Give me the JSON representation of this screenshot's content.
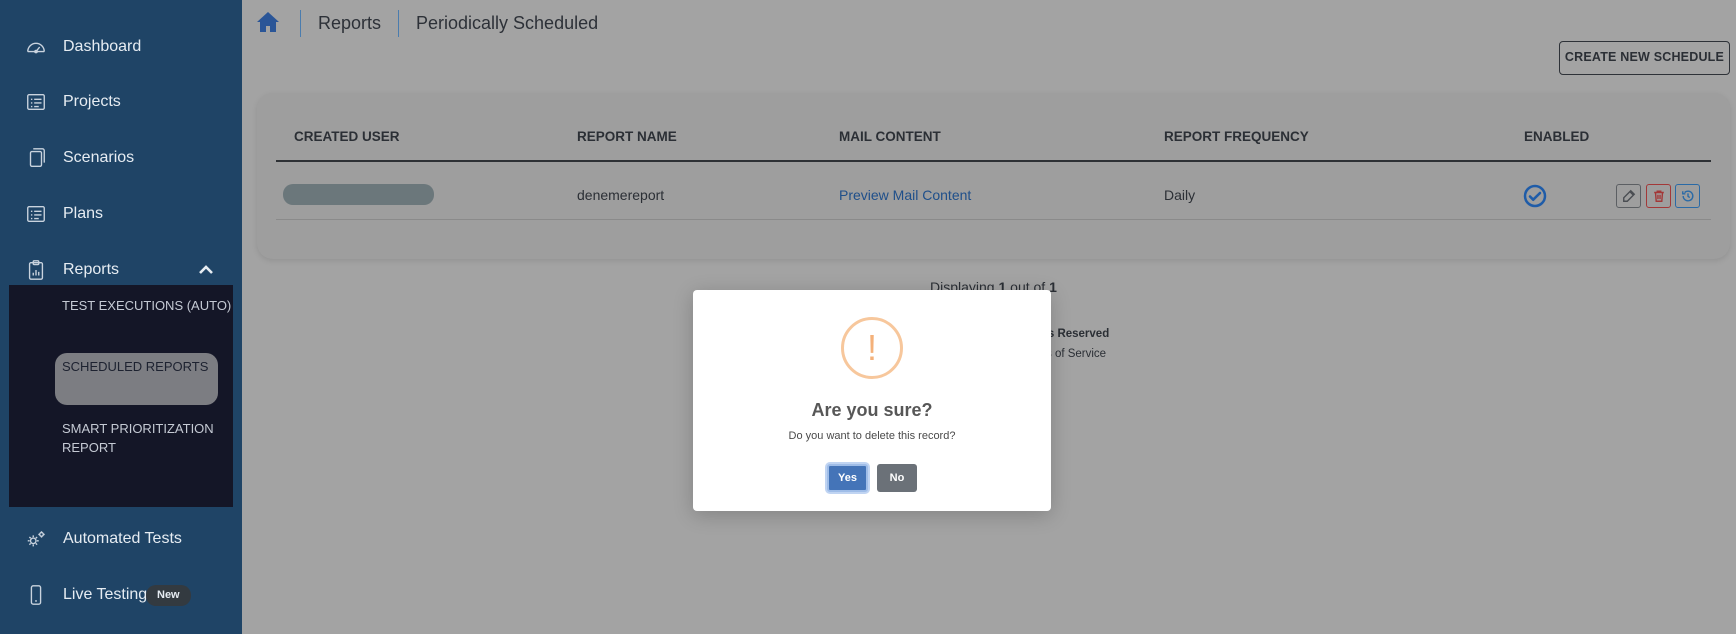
{
  "sidebar": {
    "items": [
      {
        "label": "Dashboard",
        "icon": "dashboard-icon"
      },
      {
        "label": "Projects",
        "icon": "list-icon"
      },
      {
        "label": "Scenarios",
        "icon": "copy-icon"
      },
      {
        "label": "Plans",
        "icon": "list-icon"
      },
      {
        "label": "Reports",
        "icon": "clipboard-chart-icon",
        "expanded": true
      },
      {
        "label": "Automated Tests",
        "icon": "gears-icon"
      },
      {
        "label": "Live Testing",
        "icon": "mobile-icon",
        "badge": "New"
      }
    ],
    "reports_submenu": [
      {
        "label": "TEST EXECUTIONS (AUTO)"
      },
      {
        "label": "SCHEDULED REPORTS",
        "active": true
      },
      {
        "label": "SMART PRIORITIZATION REPORT"
      }
    ]
  },
  "breadcrumb": {
    "items": [
      "Reports",
      "Periodically Scheduled"
    ]
  },
  "toolbar": {
    "create_label": "CREATE NEW SCHEDULE"
  },
  "table": {
    "columns": [
      "CREATED USER",
      "REPORT NAME",
      "MAIL CONTENT",
      "REPORT FREQUENCY",
      "ENABLED"
    ],
    "rows": [
      {
        "report_name": "denemereport",
        "mail_content": "Preview Mail Content",
        "frequency": "Daily",
        "enabled": true
      }
    ]
  },
  "pager": {
    "prefix": "Displaying",
    "current": "1",
    "middle": "out of",
    "total": "1"
  },
  "footer": {
    "line1": "hts Reserved",
    "line2": "s of Service"
  },
  "modal": {
    "title": "Are you sure?",
    "text": "Do you want to delete this record?",
    "yes_label": "Yes",
    "no_label": "No",
    "icon_glyph": "!"
  },
  "colors": {
    "sidebar_bg": "#1f4466",
    "submenu_bg": "#141627",
    "accent_blue": "#4474b8",
    "warning": "#f7c79c"
  }
}
